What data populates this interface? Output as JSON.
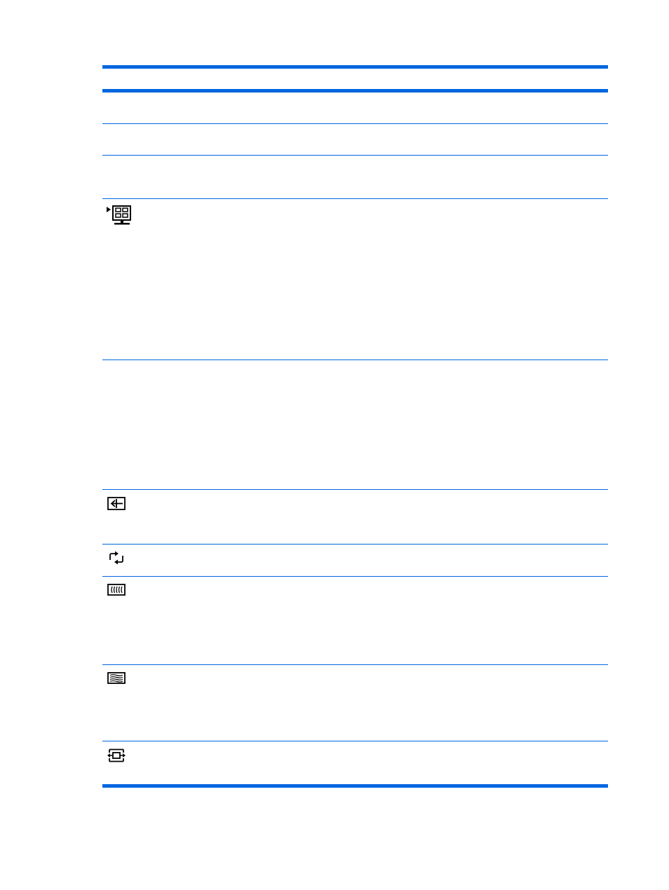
{
  "colors": {
    "accent": "#0066e0",
    "icon_stroke": "#000000"
  },
  "table": {
    "header": {
      "column_1": "",
      "column_2": ""
    },
    "rows": [
      {
        "icon": null,
        "text": ""
      },
      {
        "icon": null,
        "text": ""
      },
      {
        "icon": null,
        "text": ""
      },
      {
        "icon": "monitor-menu-icon",
        "text": ""
      },
      {
        "icon": null,
        "text": ""
      },
      {
        "icon": "image-position-icon",
        "text": ""
      },
      {
        "icon": "auto-adjust-icon",
        "text": ""
      },
      {
        "icon": "clock-icon",
        "text": ""
      },
      {
        "icon": "clock-phase-icon",
        "text": ""
      },
      {
        "icon": "horizontal-position-icon",
        "text": ""
      }
    ]
  }
}
